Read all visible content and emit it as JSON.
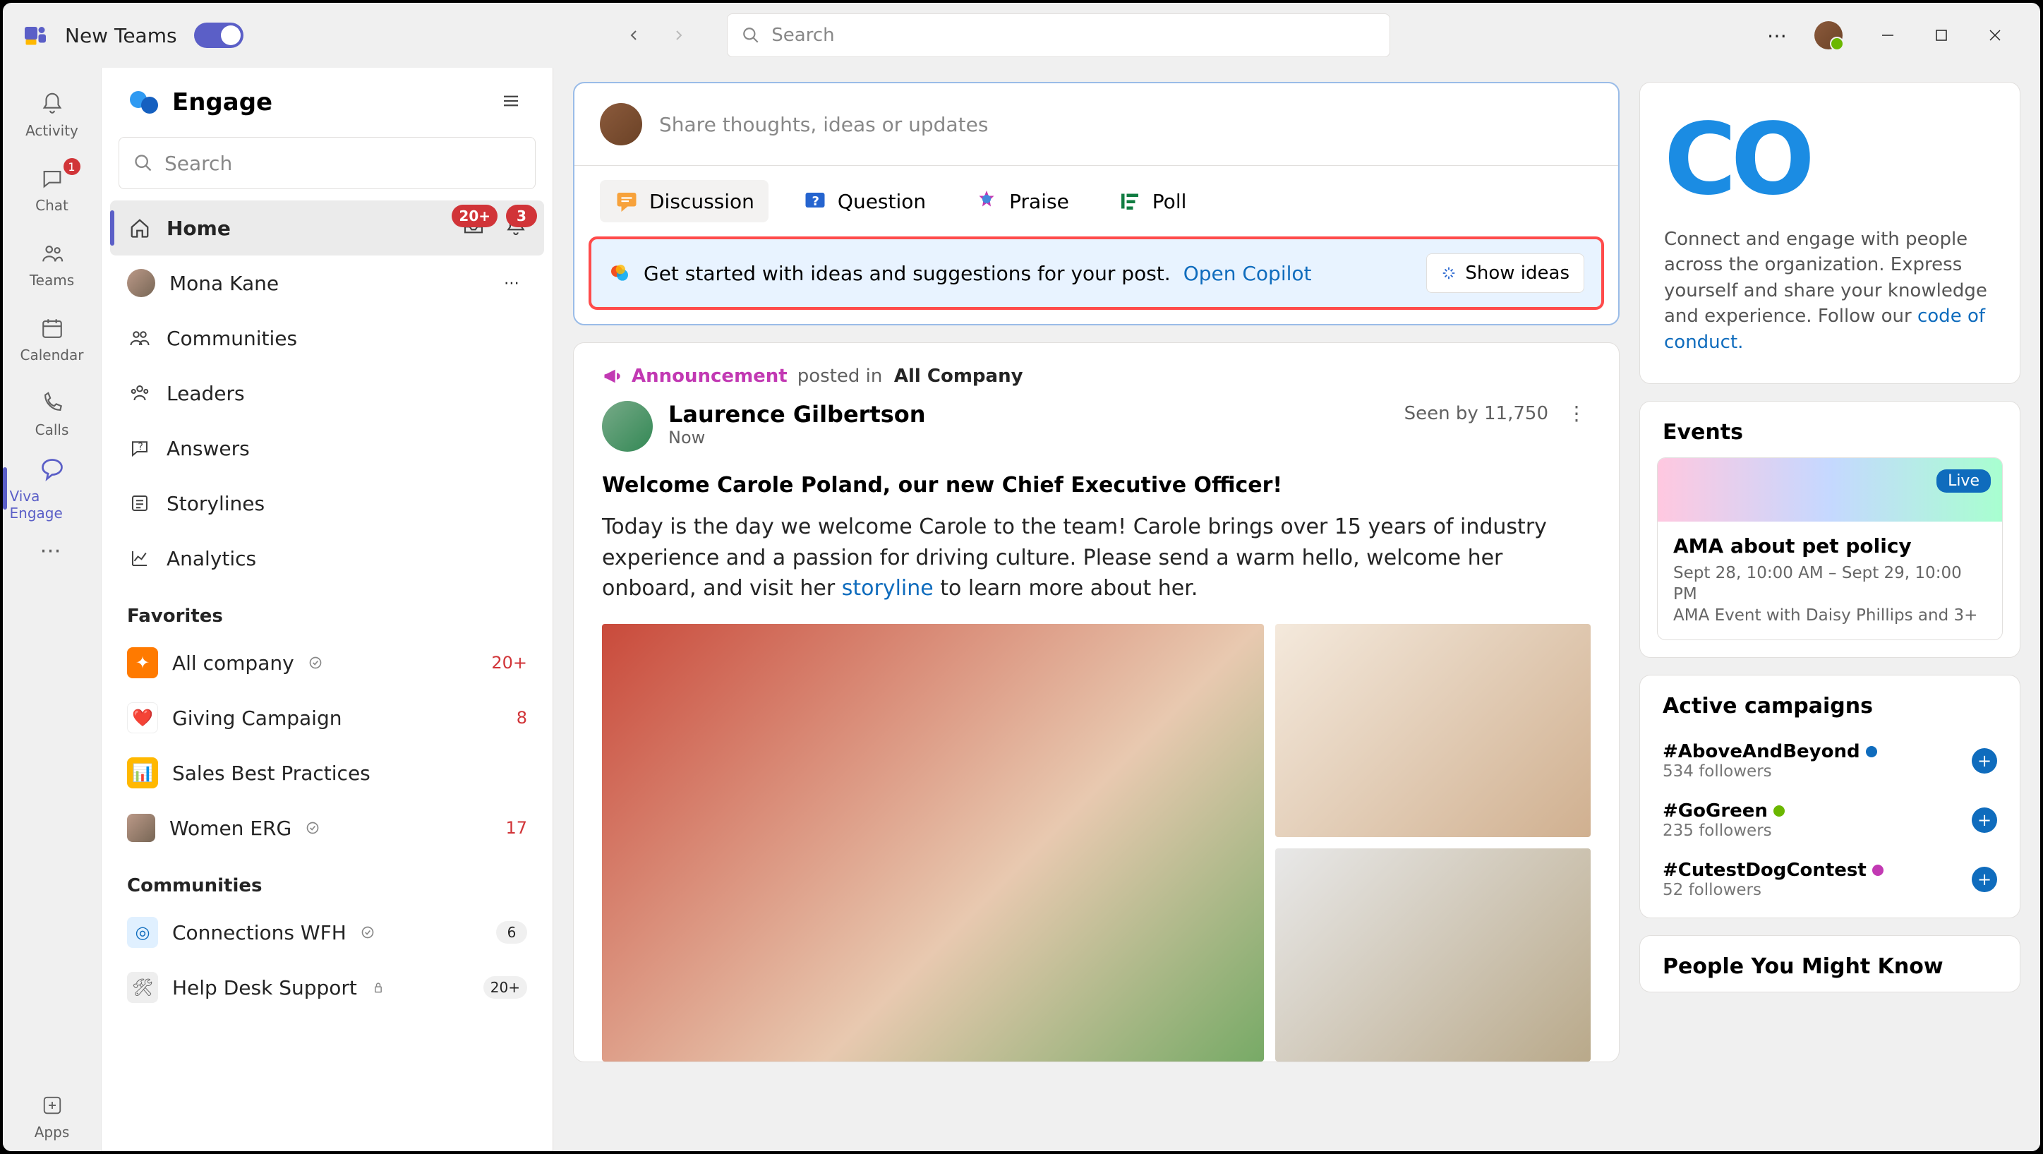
{
  "titlebar": {
    "app": "New Teams",
    "search_placeholder": "Search"
  },
  "apprail": {
    "items": [
      {
        "key": "activity",
        "label": "Activity"
      },
      {
        "key": "chat",
        "label": "Chat",
        "badge": "1"
      },
      {
        "key": "teams",
        "label": "Teams"
      },
      {
        "key": "calendar",
        "label": "Calendar"
      },
      {
        "key": "calls",
        "label": "Calls"
      },
      {
        "key": "viva",
        "label": "Viva Engage",
        "selected": true
      }
    ],
    "overflow_label": "",
    "apps_label": "Apps"
  },
  "sidepanel": {
    "title": "Engage",
    "search_placeholder": "Search",
    "nav": [
      {
        "key": "home",
        "label": "Home",
        "selected": true,
        "inbox_badge": "20+",
        "bell_badge": "3"
      },
      {
        "key": "user",
        "label": "Mona Kane",
        "avatar": true,
        "more": true
      },
      {
        "key": "communities",
        "label": "Communities"
      },
      {
        "key": "leaders",
        "label": "Leaders"
      },
      {
        "key": "answers",
        "label": "Answers"
      },
      {
        "key": "storylines",
        "label": "Storylines"
      },
      {
        "key": "analytics",
        "label": "Analytics"
      }
    ],
    "favorites_label": "Favorites",
    "favorites": [
      {
        "label": "All company",
        "count": "20+",
        "color": "#ff7a00"
      },
      {
        "label": "Giving Campaign",
        "count": "8",
        "color": "#fff",
        "fg": "#d13438"
      },
      {
        "label": "Sales Best Practices",
        "count": "",
        "color": "#ffb800"
      },
      {
        "label": "Women ERG",
        "count": "17",
        "avatar": true
      }
    ],
    "communities_label": "Communities",
    "communities": [
      {
        "label": "Connections WFH",
        "count": "6",
        "color": "#e0f0ff",
        "fg": "#0f6cbd",
        "gray": true
      },
      {
        "label": "Help Desk Support",
        "count": "20+",
        "color": "#eee",
        "fg": "#666",
        "gray": true,
        "lock": true
      }
    ]
  },
  "composer": {
    "prompt": "Share thoughts, ideas or updates",
    "tabs": [
      {
        "key": "discussion",
        "label": "Discussion",
        "selected": true
      },
      {
        "key": "question",
        "label": "Question"
      },
      {
        "key": "praise",
        "label": "Praise"
      },
      {
        "key": "poll",
        "label": "Poll"
      }
    ],
    "copilot_text": "Get started with ideas and suggestions for your post.",
    "copilot_link": "Open Copilot",
    "show_ideas": "Show ideas"
  },
  "post": {
    "announcement": "Announcement",
    "posted_in": "posted in",
    "destination": "All Company",
    "author": "Laurence Gilbertson",
    "time": "Now",
    "seen": "Seen by 11,750",
    "title": "Welcome Carole Poland, our new Chief Executive Officer!",
    "body_pre": "Today is the day we welcome Carole to the team! Carole brings over 15 years of industry experience and a passion for driving culture. Please send a warm hello, welcome her onboard, and visit her ",
    "body_link": "storyline",
    "body_post": " to learn more about her."
  },
  "rightcol": {
    "promo_text": "Connect and engage with people across the organization. Express yourself and share your knowledge and experience. Follow our ",
    "promo_link": "code of conduct.",
    "events_label": "Events",
    "event": {
      "title": "AMA about pet policy",
      "sub1": "Sept 28, 10:00 AM – Sept 29, 10:00 PM",
      "sub2": "AMA Event with Daisy Phillips and 3+",
      "live": "Live"
    },
    "campaigns_label": "Active campaigns",
    "campaigns": [
      {
        "tag": "#AboveAndBeyond",
        "sub": "534 followers",
        "dot": "#0f6cbd"
      },
      {
        "tag": "#GoGreen",
        "sub": "235 followers",
        "dot": "#6bb700"
      },
      {
        "tag": "#CutestDogContest",
        "sub": "52 followers",
        "dot": "#c239b3"
      }
    ],
    "people_label": "People You Might Know"
  }
}
